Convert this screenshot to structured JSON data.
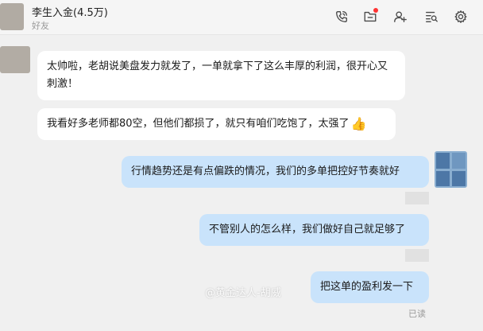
{
  "header": {
    "contact_name": "李生入金(4.5万)",
    "contact_subtitle": "好友",
    "icons": [
      "phone-icon",
      "folder-icon",
      "add-contact-icon",
      "search-history-icon",
      "settings-icon"
    ],
    "notification_color": "#ff3333"
  },
  "messages": [
    {
      "from": "contact",
      "text": "太帅啦，老胡说美盘发力就发了，一单就拿下了这么丰厚的利润，很开心又刺激！"
    },
    {
      "from": "contact",
      "text": "我看好多老师都80空，但他们都损了，就只有咱们吃饱了，太强了",
      "emoji": "👍"
    },
    {
      "from": "me",
      "text": "行情趋势还是有点偏跌的情况，我们的多单把控好节奏就好"
    },
    {
      "from": "me",
      "text": "不管别人的怎么样，我们做好自己就足够了"
    },
    {
      "from": "me",
      "text": "把这单的盈利发一下",
      "status": "已读"
    }
  ],
  "watermark": {
    "text": "@黄金达人-胡威"
  },
  "colors": {
    "incoming_bubble": "#ffffff",
    "outgoing_bubble": "#c9e3fb",
    "background": "#f0f0f0"
  }
}
